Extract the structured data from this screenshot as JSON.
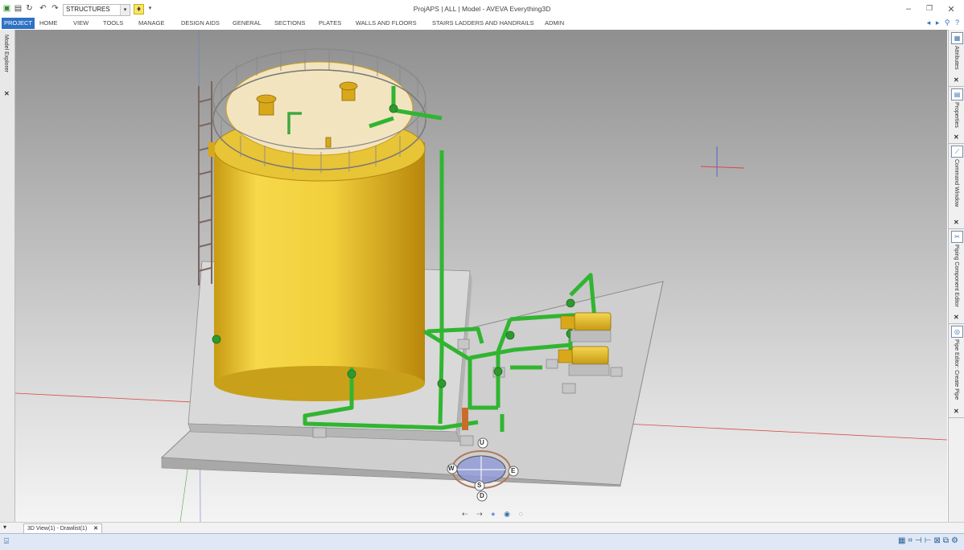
{
  "window": {
    "title": "ProjAPS | ALL | Model - AVEVA Everything3D",
    "min_glyph": "–",
    "max_glyph": "❐",
    "close_glyph": "✕"
  },
  "qat": {
    "combo_value": "STRUCTURES"
  },
  "ribbon": {
    "tabs": [
      "PROJECT",
      "HOME",
      "VIEW",
      "TOOLS",
      "MANAGE",
      "DESIGN AIDS",
      "GENERAL",
      "SECTIONS",
      "PLATES",
      "WALLS AND FLOORS",
      "STAIRS LADDERS AND HANDRAILS",
      "ADMIN"
    ],
    "active_tab": "PROJECT"
  },
  "left_panel": {
    "label": "Model Explorer",
    "close": "✕"
  },
  "right_panel": {
    "sections": [
      {
        "label": "Attributes",
        "icon": "attributes-icon",
        "close": "✕"
      },
      {
        "label": "Properties",
        "icon": "properties-icon",
        "close": "✕"
      },
      {
        "label": "Command Window",
        "icon": "command-window-icon",
        "close": "✕"
      },
      {
        "label": "Piping Component Editor",
        "icon": "piping-component-editor-icon",
        "close": "✕"
      },
      {
        "label": "Pipe Editor: Create Pipe",
        "icon": "pipe-editor-icon",
        "close": "✕"
      }
    ]
  },
  "viewcube": {
    "u": "U",
    "w": "W",
    "e": "E",
    "s": "S",
    "d": "D"
  },
  "bottom": {
    "doc_tab": "3D View(1) - Drawlist(1)",
    "doc_tab_close": "✕"
  },
  "colors": {
    "accent": "#2f72c4",
    "tank": "#f0cf3a",
    "pipe": "#31b531",
    "concrete": "#d6d6d6"
  }
}
